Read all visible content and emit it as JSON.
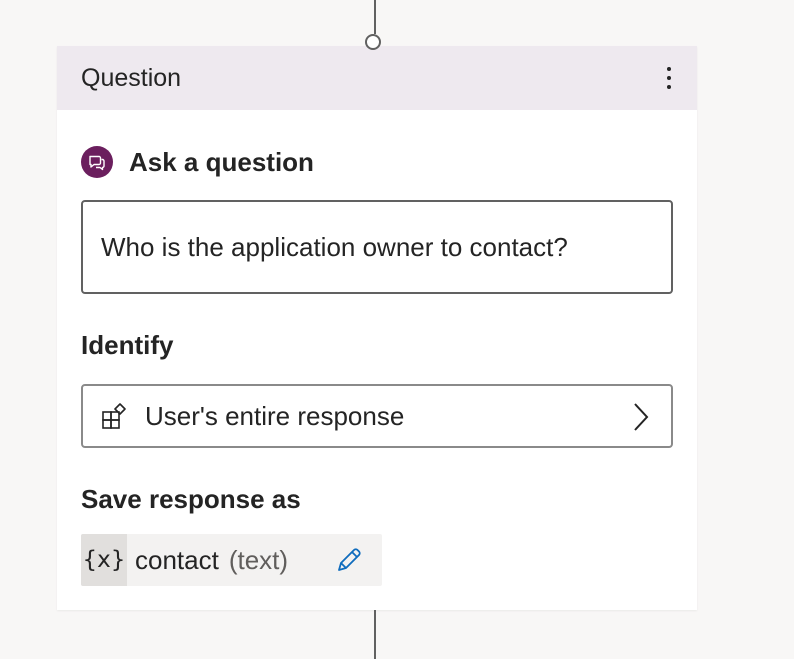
{
  "card": {
    "title": "Question",
    "more_icon": "more-vertical-icon"
  },
  "ask": {
    "heading": "Ask a question",
    "icon": "chat-bubble-icon",
    "icon_color": "#6b1f5e",
    "question_text": "Who is the application owner to contact?"
  },
  "identify": {
    "label": "Identify",
    "value": "User's entire response",
    "icon": "entity-icon",
    "chevron": "chevron-right-icon"
  },
  "save": {
    "label": "Save response as",
    "var_symbol": "{x}",
    "var_name": "contact",
    "var_type": "(text)",
    "edit_icon": "pencil-icon",
    "edit_color": "#0f6cbd"
  },
  "colors": {
    "header_bg": "#eee9ef",
    "canvas_bg": "#f8f7f6"
  }
}
